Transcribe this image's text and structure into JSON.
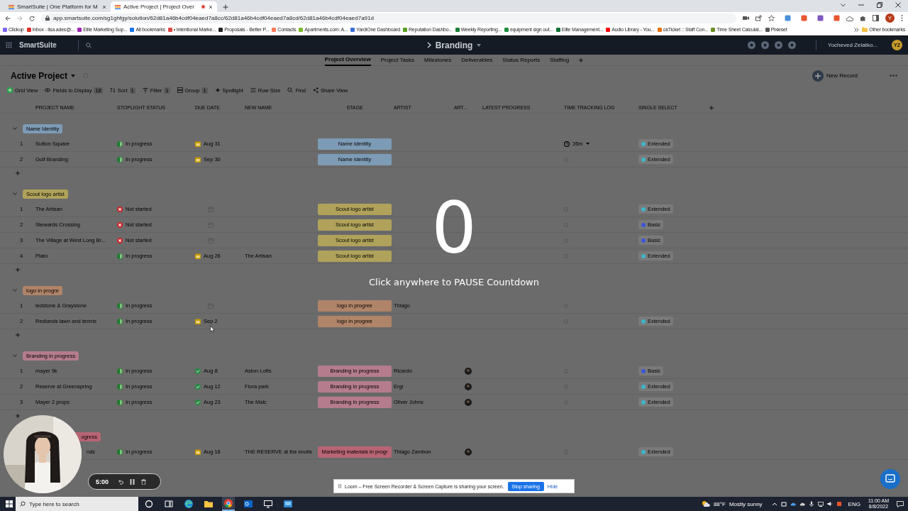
{
  "browser": {
    "tabs": [
      {
        "title": "SmartSuite | One Platform for M",
        "selected": false,
        "recording": false
      },
      {
        "title": "Active Project | Project Over",
        "selected": true,
        "recording": true
      }
    ],
    "url": "app.smartsuite.com/sg1ghfgy/solution/62d81a46b4cdf04eaed7a8cc/62d81a46b4cdf04eaed7a8cd/62d81a46b4cdf04eaed7a91d",
    "profile": "Y",
    "bookmarks": [
      {
        "label": "Clickup",
        "color": "#7b68ee"
      },
      {
        "label": "Inbox - lisa.ades@...",
        "color": "#d93025"
      },
      {
        "label": "Elite Marketing Sup...",
        "color": "#9c27b0"
      },
      {
        "label": "All bookmarks",
        "color": "#1a73e8"
      },
      {
        "label": "• Intentional Marke...",
        "color": "#e04545"
      },
      {
        "label": "Proposals - Better P...",
        "color": "#222222"
      },
      {
        "label": "Contacts",
        "color": "#ff7a59"
      },
      {
        "label": "Apartments.com: A...",
        "color": "#7cb82f"
      },
      {
        "label": "YardiOne Dashboard",
        "color": "#3a6fd8"
      },
      {
        "label": "Reputation Dashbo...",
        "color": "#5a9e1f"
      },
      {
        "label": "Weekly Reporting...",
        "color": "#188038"
      },
      {
        "label": "equipment sign out...",
        "color": "#1e8e3e"
      },
      {
        "label": "Elite Management...",
        "color": "#137333"
      },
      {
        "label": "Audio Library - You...",
        "color": "#ff0000"
      },
      {
        "label": "osTicket :: Staff Con...",
        "color": "#e8710a"
      },
      {
        "label": "Time Sheet Calculat...",
        "color": "#6b8e23"
      },
      {
        "label": "Pixieset",
        "color": "#555555"
      }
    ],
    "other_bookmarks": "Other bookmarks"
  },
  "app": {
    "logo": "SmartSuite",
    "solution": "Branding",
    "user": {
      "name": "Yocheved Zelatko...",
      "initials": "YZ"
    },
    "views": [
      {
        "label": "Project Overview",
        "selected": true
      },
      {
        "label": "Project Tasks",
        "selected": false
      },
      {
        "label": "Milestones",
        "selected": false
      },
      {
        "label": "Deliverables",
        "selected": false
      },
      {
        "label": "Status Reports",
        "selected": false
      },
      {
        "label": "Staffing",
        "selected": false
      }
    ],
    "page_title": "Active Project",
    "new_record": "New Record",
    "toolbar": [
      {
        "label": "Grid View",
        "kind": "view"
      },
      {
        "label": "Fields to Display",
        "count": "18",
        "kind": "fields"
      },
      {
        "label": "Sort",
        "count": "1",
        "kind": "sort"
      },
      {
        "label": "Filter",
        "count": "1",
        "kind": "filter"
      },
      {
        "label": "Group",
        "count": "1",
        "kind": "group"
      },
      {
        "label": "Spotlight",
        "kind": "spotlight"
      },
      {
        "label": "Row Size",
        "kind": "rowsize"
      },
      {
        "label": "Find",
        "kind": "find"
      },
      {
        "label": "Share View",
        "kind": "share"
      }
    ],
    "columns": [
      "PROJECT NAME",
      "STOPLIGHT STATUS",
      "DUE DATE",
      "NEW NAME",
      "STAGE",
      "ARTIST",
      "ART...",
      "LATEST PROGRESS",
      "TIME TRACKING LOG",
      "SINGLE SELECT"
    ],
    "groups": [
      {
        "label": "Name Identity",
        "color": "#7d9bb5",
        "clipped": false,
        "rows": [
          {
            "num": "1",
            "name": "Sutton Square",
            "status": {
              "label": "In progress",
              "kind": "in_progress"
            },
            "due": {
              "label": "Aug 31",
              "kind": "upcoming"
            },
            "stage": "Name Identity",
            "time_log": "35m",
            "select": {
              "label": "Extended",
              "color": "#3fb5c8"
            }
          },
          {
            "num": "2",
            "name": "Gulf Branding",
            "status": {
              "label": "In progress",
              "kind": "in_progress"
            },
            "due": {
              "label": "Sep 30",
              "kind": "upcoming"
            },
            "stage": "Name Identity",
            "select": {
              "label": "Extended",
              "color": "#3fb5c8"
            }
          }
        ]
      },
      {
        "label": "Scout logo artist",
        "color": "#b0a25a",
        "clipped": false,
        "rows": [
          {
            "num": "1",
            "name": "The Artisan",
            "status": {
              "label": "Not started",
              "kind": "not_started"
            },
            "due": {
              "kind": "none"
            },
            "stage": "Scout logo artist",
            "select": {
              "label": "Extended",
              "color": "#3fb5c8"
            }
          },
          {
            "num": "2",
            "name": "Stewards Crossing",
            "status": {
              "label": "Not started",
              "kind": "not_started"
            },
            "due": {
              "kind": "none"
            },
            "stage": "Scout logo artist",
            "select": {
              "label": "Basic",
              "color": "#3b55d9"
            }
          },
          {
            "num": "3",
            "name": "The Village at West Long Br...",
            "status": {
              "label": "Not started",
              "kind": "not_started"
            },
            "due": {
              "kind": "none"
            },
            "stage": "Scout logo artist",
            "select": {
              "label": "Basic",
              "color": "#3b55d9"
            }
          },
          {
            "num": "4",
            "name": "Plato",
            "status": {
              "label": "In progress",
              "kind": "in_progress"
            },
            "due": {
              "label": "Aug 26",
              "kind": "upcoming"
            },
            "new_name": "The Artisan",
            "stage": "Scout logo artist",
            "select": {
              "label": "Extended",
              "color": "#3fb5c8"
            }
          }
        ]
      },
      {
        "label": "logo in progre",
        "color": "#b08468",
        "clipped": false,
        "rows": [
          {
            "num": "1",
            "name": "ledstone & Graystone",
            "status": {
              "label": "In progress",
              "kind": "in_progress"
            },
            "due": {
              "kind": "none"
            },
            "stage": "logo in progree",
            "artist": "Thiago"
          },
          {
            "num": "2",
            "name": "Redlands lawn and tennis",
            "status": {
              "label": "In progress",
              "kind": "in_progress"
            },
            "due": {
              "label": "Sep 2",
              "kind": "upcoming"
            },
            "stage": "logo in progree",
            "select": {
              "label": "Extended",
              "color": "#3fb5c8"
            }
          }
        ]
      },
      {
        "label": "Branding in progress",
        "color": "#b47c8c",
        "clipped": false,
        "rows": [
          {
            "num": "1",
            "name": "mayer 9k",
            "status": {
              "label": "In progress",
              "kind": "in_progress"
            },
            "due": {
              "label": "Aug 8",
              "kind": "done"
            },
            "new_name": "Aston Lofts",
            "stage": "Branding in progress",
            "artist": "Ricardo",
            "avatar": true,
            "select": {
              "label": "Basic",
              "color": "#3b55d9"
            }
          },
          {
            "num": "2",
            "name": "Reserve at Greenspring",
            "status": {
              "label": "In progress",
              "kind": "in_progress"
            },
            "due": {
              "label": "Aug 12",
              "kind": "done"
            },
            "new_name": "Flora park",
            "stage": "Branding in progress",
            "artist": "Ergi",
            "avatar": true,
            "select": {
              "label": "Extended",
              "color": "#3fb5c8"
            }
          },
          {
            "num": "3",
            "name": "Mayer 2 props",
            "status": {
              "label": "In progress",
              "kind": "in_progress"
            },
            "due": {
              "label": "Aug 23",
              "kind": "done"
            },
            "new_name": "The Malc",
            "stage": "Branding in progress",
            "artist": "Oliver Johns",
            "avatar": true,
            "select": {
              "label": "Extended",
              "color": "#3fb5c8"
            }
          }
        ]
      },
      {
        "label": "ogress",
        "color": "#b86474",
        "clipped": true,
        "rows": [
          {
            "name": "nds",
            "status": {
              "label": "In progress",
              "kind": "in_progress"
            },
            "due": {
              "label": "Aug 18",
              "kind": "upcoming"
            },
            "new_name": "THE RESERVE at the knolls",
            "stage": "Marketing materials in progr",
            "artist": "Thiago Zambon",
            "avatar": true,
            "select": {
              "label": "Extended",
              "color": "#3fb5c8"
            }
          }
        ]
      }
    ]
  },
  "countdown": {
    "value": "0",
    "hint": "Click anywhere to PAUSE Countdown"
  },
  "recorder": {
    "time": "5:00"
  },
  "loom": {
    "message": "Loom – Free Screen Recorder & Screen Capture is sharing your screen.",
    "stop": "Stop sharing",
    "hide": "Hide"
  },
  "taskbar": {
    "search_placeholder": "Type here to search",
    "apps": [
      {
        "kind": "cortana",
        "active": false
      },
      {
        "kind": "taskview",
        "active": false
      },
      {
        "kind": "edge",
        "active": false
      },
      {
        "kind": "explorer",
        "active": false
      },
      {
        "kind": "chrome",
        "active": true
      },
      {
        "kind": "outlook",
        "active": false
      },
      {
        "kind": "monitor",
        "active": false
      },
      {
        "kind": "app",
        "active": false
      }
    ],
    "temperature": "88°F",
    "weather": "Mostly sunny",
    "language": "ENG",
    "time": "11:00 AM",
    "date": "8/8/2022"
  }
}
